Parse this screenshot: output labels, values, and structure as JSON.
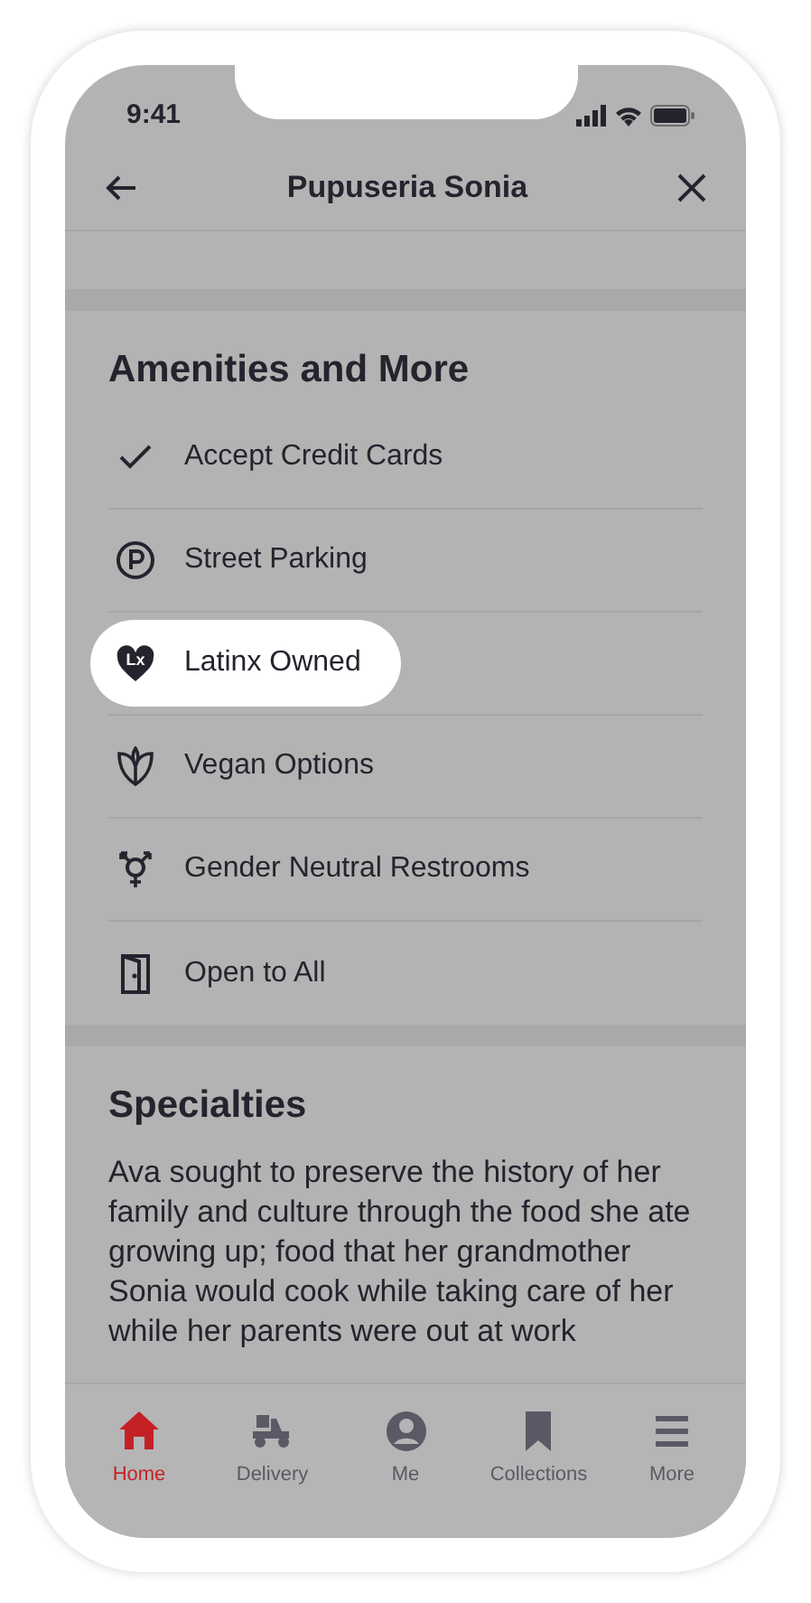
{
  "status_bar": {
    "time": "9:41"
  },
  "header": {
    "title": "Pupuseria Sonia"
  },
  "amenities": {
    "title": "Amenities and More",
    "items": [
      {
        "kind": "check",
        "label": "Accept Credit Cards",
        "highlighted": false
      },
      {
        "kind": "parking",
        "label": "Street Parking",
        "highlighted": false
      },
      {
        "kind": "heart",
        "icon_text": "Lx",
        "label": "Latinx Owned",
        "highlighted": true
      },
      {
        "kind": "leaf",
        "label": "Vegan Options",
        "highlighted": false
      },
      {
        "kind": "gender",
        "label": "Gender Neutral Restrooms",
        "highlighted": false
      },
      {
        "kind": "door",
        "label": "Open to All",
        "highlighted": false
      }
    ]
  },
  "specialties": {
    "title": "Specialties",
    "text": "Ava sought to preserve the history of her family and culture through the food she ate growing up; food that her grandmother Sonia would cook while taking care of her while her parents were out at work"
  },
  "tab_bar": [
    {
      "kind": "home",
      "label": "Home",
      "selected": true
    },
    {
      "kind": "delivery",
      "label": "Delivery",
      "selected": false
    },
    {
      "kind": "me",
      "label": "Me",
      "selected": false
    },
    {
      "kind": "collections",
      "label": "Collections",
      "selected": false
    },
    {
      "kind": "more",
      "label": "More",
      "selected": false
    }
  ]
}
